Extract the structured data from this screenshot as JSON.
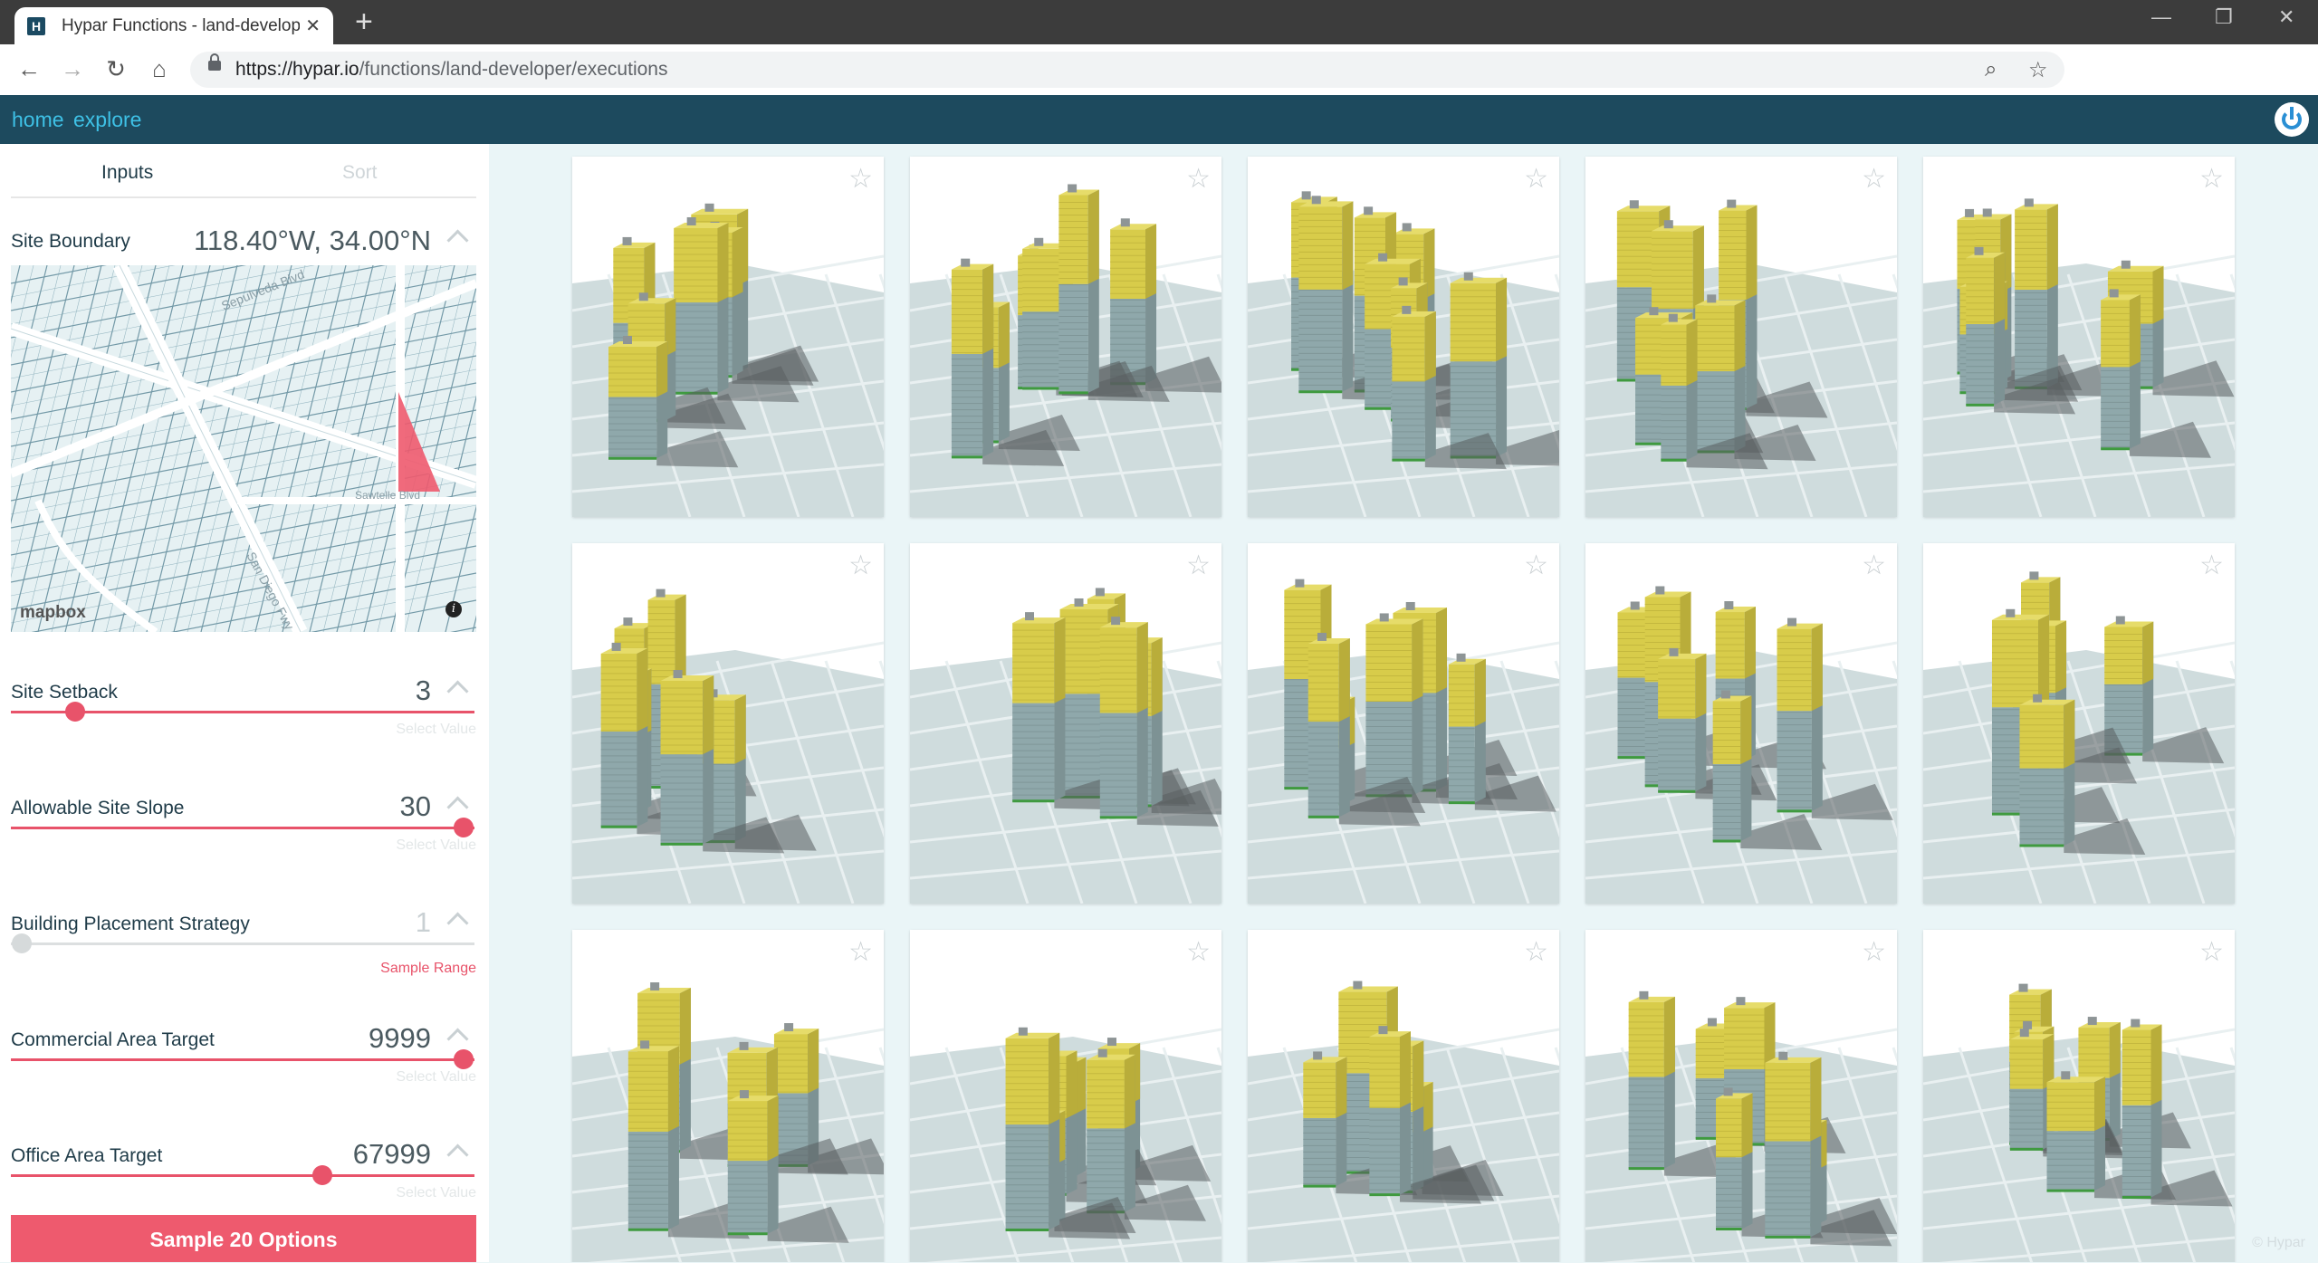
{
  "browser": {
    "tab_title": "Hypar Functions - land-develope",
    "favicon_letter": "H",
    "url_host": "https://hypar.io",
    "url_path": "/functions/land-developer/executions"
  },
  "header": {
    "nav": [
      "home",
      "explore"
    ]
  },
  "panel": {
    "tabs": [
      "Inputs",
      "Sort"
    ],
    "site_boundary": {
      "label": "Site Boundary",
      "value": "118.40°W, 34.00°N"
    },
    "map": {
      "credit": "mapbox",
      "info": "i",
      "street_labels": [
        "Sepulveda Blvd",
        "San Diego Fwy",
        "Sawtelle Blvd"
      ]
    },
    "params": [
      {
        "label": "Site Setback",
        "value": "3",
        "hint": "Select Value",
        "fraction": 0.12,
        "mode": "value"
      },
      {
        "label": "Allowable Site Slope",
        "value": "30",
        "hint": "Select Value",
        "fraction": 1.0,
        "mode": "value"
      },
      {
        "label": "Building Placement Strategy",
        "value": "1",
        "hint": "Sample Range",
        "fraction": 0.0,
        "mode": "range"
      },
      {
        "label": "Commercial Area Target",
        "value": "9999",
        "hint": "Select Value",
        "fraction": 1.0,
        "mode": "value"
      },
      {
        "label": "Office Area Target",
        "value": "67999",
        "hint": "Select Value",
        "fraction": 0.68,
        "mode": "value"
      }
    ],
    "sample_button": "Sample 20 Options"
  },
  "results": {
    "star_icon": "star-outline-icon",
    "watermark": "© Hypar",
    "count_visible": 15
  },
  "colors": {
    "header": "#1d4a5e",
    "link": "#3ec1e6",
    "accent": "#ee5a6e",
    "building_top": "#d8cc4a",
    "building_bottom": "#8fa8ab",
    "ground": "#cfdcdd"
  }
}
